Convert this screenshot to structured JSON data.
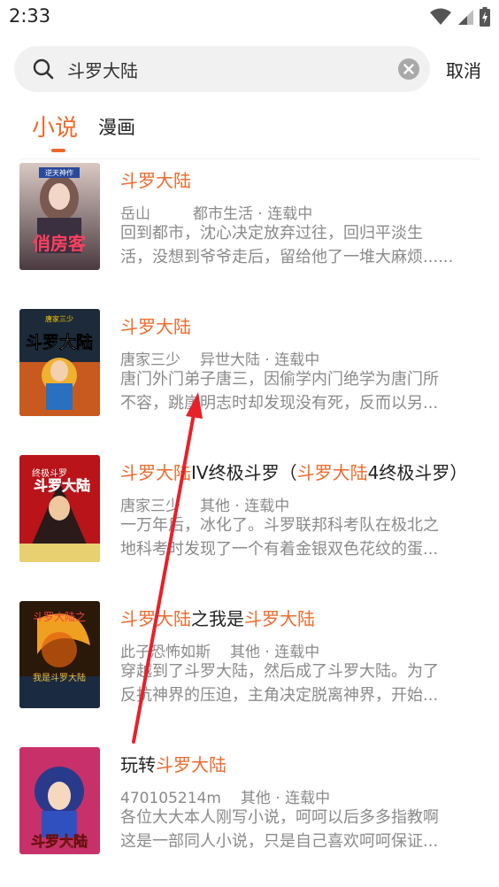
{
  "status": {
    "time": "2:33"
  },
  "search": {
    "query": "斗罗大陆",
    "placeholder": "",
    "cancel_label": "取消"
  },
  "tabs": [
    {
      "label": "小说",
      "active": true
    },
    {
      "label": "漫画",
      "active": false
    }
  ],
  "colors": {
    "accent": "#ee6a2c",
    "meta": "#8a8a8a"
  },
  "results": [
    {
      "title_parts": [
        {
          "text": "斗罗大陆",
          "hl": true
        }
      ],
      "author": "岳山",
      "category": "都市生活",
      "state": "连载中",
      "desc_line1": "回到都市，沈心决定放弃过往，回归平淡生",
      "desc_line2": "活，没想到爷爷走后，留给他了一堆大麻烦......",
      "cover_text": "俏房客",
      "cover_badge": "逆天神作"
    },
    {
      "title_parts": [
        {
          "text": "斗罗大陆",
          "hl": true
        }
      ],
      "author": "唐家三少",
      "category": "异世大陆",
      "state": "连载中",
      "desc_line1": "唐门外门弟子唐三，因偷学内门绝学为唐门所",
      "desc_line2": "不容，跳崖明志时却发现没有死，反而以另...",
      "cover_text": "斗罗大陆",
      "cover_badge": "唐家三少"
    },
    {
      "title_parts": [
        {
          "text": "斗罗大陆",
          "hl": true
        },
        {
          "text": "IV终极斗罗（",
          "hl": false
        },
        {
          "text": "斗罗大陆",
          "hl": true
        },
        {
          "text": "4终极斗罗）",
          "hl": false
        }
      ],
      "author": "唐家三少",
      "category": "其他",
      "state": "连载中",
      "desc_line1": "一万年后，冰化了。斗罗联邦科考队在极北之",
      "desc_line2": "地科考时发现了一个有着金银双色花纹的蛋...",
      "cover_text": "斗罗大陆",
      "cover_badge": "终极斗罗"
    },
    {
      "title_parts": [
        {
          "text": "斗罗大陆",
          "hl": true
        },
        {
          "text": "之我是",
          "hl": false
        },
        {
          "text": "斗罗大陆",
          "hl": true
        }
      ],
      "author": "此子恐怖如斯",
      "category": "其他",
      "state": "连载中",
      "desc_line1": "穿越到了斗罗大陆，然后成了斗罗大陆。为了",
      "desc_line2": "反抗神界的压迫，主角决定脱离神界，开始...",
      "cover_text": "斗罗大陆之",
      "cover_badge": "我是斗罗大陆"
    },
    {
      "title_parts": [
        {
          "text": "玩转",
          "hl": false
        },
        {
          "text": "斗罗大陆",
          "hl": true
        }
      ],
      "author": "470105214m",
      "category": "其他",
      "state": "连载中",
      "desc_line1": "各位大大本人刚写小说，呵呵以后多多指教啊",
      "desc_line2": "这是一部同人小说，只是自己喜欢呵呵保证...",
      "cover_text": "斗罗大陆",
      "cover_badge": ""
    }
  ],
  "icons": {
    "search": "search-icon",
    "clear": "clear-icon",
    "wifi": "wifi-icon",
    "signal": "signal-icon",
    "battery": "battery-icon"
  }
}
